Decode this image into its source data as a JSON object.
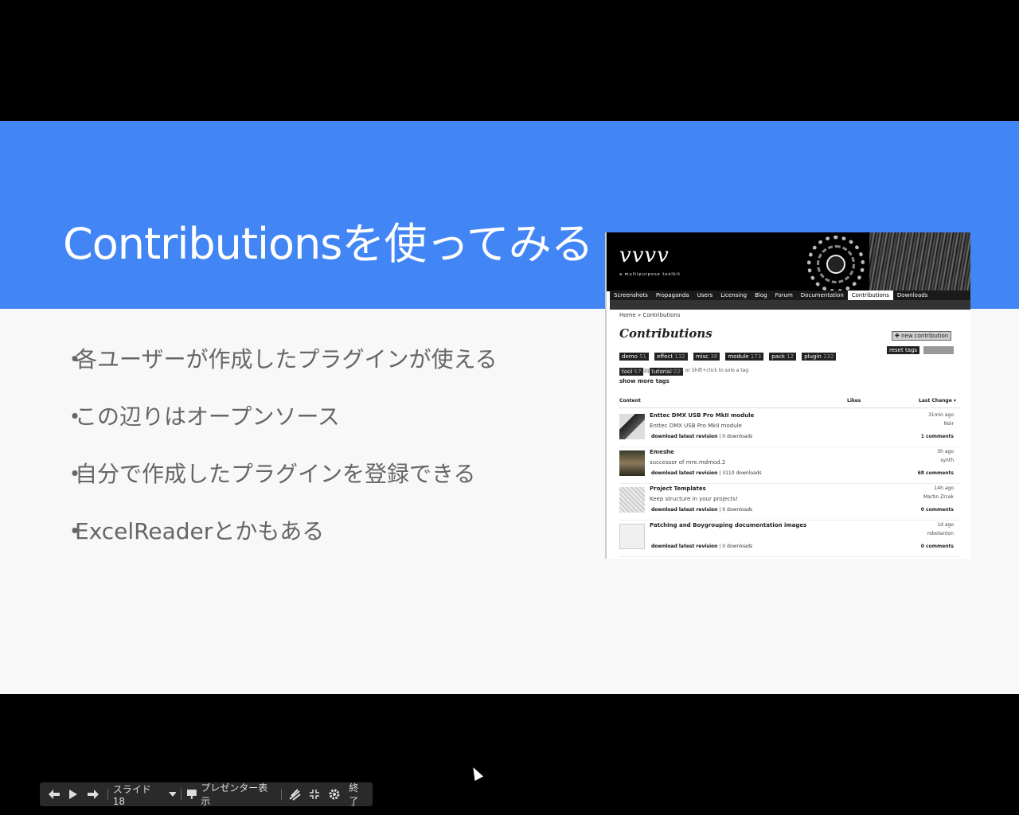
{
  "slide": {
    "title": "Contributionsを使ってみる",
    "bullets": [
      "各ユーザーが作成したプラグインが使える",
      "この辺りはオープンソース",
      "自分で作成したプラグインを登録できる",
      "ExcelReaderとかもある"
    ],
    "bullet_marker": "・",
    "colors": {
      "header": "#4285f4",
      "background": "#f8f8f8",
      "bullet_text": "#666666"
    }
  },
  "screenshot": {
    "logo": "vvvv",
    "tagline": "a multipurpose toolkit",
    "nav": [
      "Screenshots",
      "Propaganda",
      "Users",
      "Licensing",
      "Blog",
      "Forum",
      "Documentation",
      "Contributions",
      "Downloads"
    ],
    "nav_active": "Contributions",
    "breadcrumb": "Home » Contributions",
    "heading": "Contributions",
    "new_button": "✚ new contribution",
    "tags": [
      {
        "label": "demo",
        "count": "51"
      },
      {
        "label": "effect",
        "count": "132"
      },
      {
        "label": "misc",
        "count": "38"
      },
      {
        "label": "module",
        "count": "173"
      },
      {
        "label": "pack",
        "count": "12"
      },
      {
        "label": "plugin",
        "count": "132"
      },
      {
        "label": "tool",
        "count": "57"
      },
      {
        "label": "tutorial",
        "count": "22"
      }
    ],
    "reset_tags": "reset tags",
    "hint": "Click to toggle, doubleclick or Shift+click to solo a tag",
    "show_more": "show more tags",
    "columns": {
      "content": "Content",
      "likes": "Likes",
      "last_change": "Last Change ▾"
    },
    "rows": [
      {
        "name": "Enttec DMX USB Pro MkII module",
        "desc": "Enttec DMX USB Pro MkII module",
        "download": "download latest revision",
        "downloads": "0 downloads",
        "time": "31min ago",
        "author": "Noir",
        "comments": "1 comments"
      },
      {
        "name": "Emeshe",
        "desc": "successor of mre.mdmod.2",
        "download": "download latest revision",
        "downloads": "3110 downloads",
        "time": "5h ago",
        "author": "synth",
        "comments": "68 comments"
      },
      {
        "name": "Project Templates",
        "desc": "Keep structure in your projects!",
        "download": "download latest revision",
        "downloads": "0 downloads",
        "time": "14h ago",
        "author": "Martin Zrcek",
        "comments": "0 comments"
      },
      {
        "name": "Patching and Boygrouping documentation images",
        "desc": "",
        "download": "download latest revision",
        "downloads": "0 downloads",
        "time": "1d ago",
        "author": "robotanton",
        "comments": "0 comments"
      }
    ]
  },
  "toolbar": {
    "prev_icon": "arrow-left-icon",
    "play_icon": "play-icon",
    "next_icon": "arrow-right-icon",
    "slide_label": "スライド 18",
    "presenter_label": "プレゼンター表示",
    "exit_label": "終了"
  }
}
